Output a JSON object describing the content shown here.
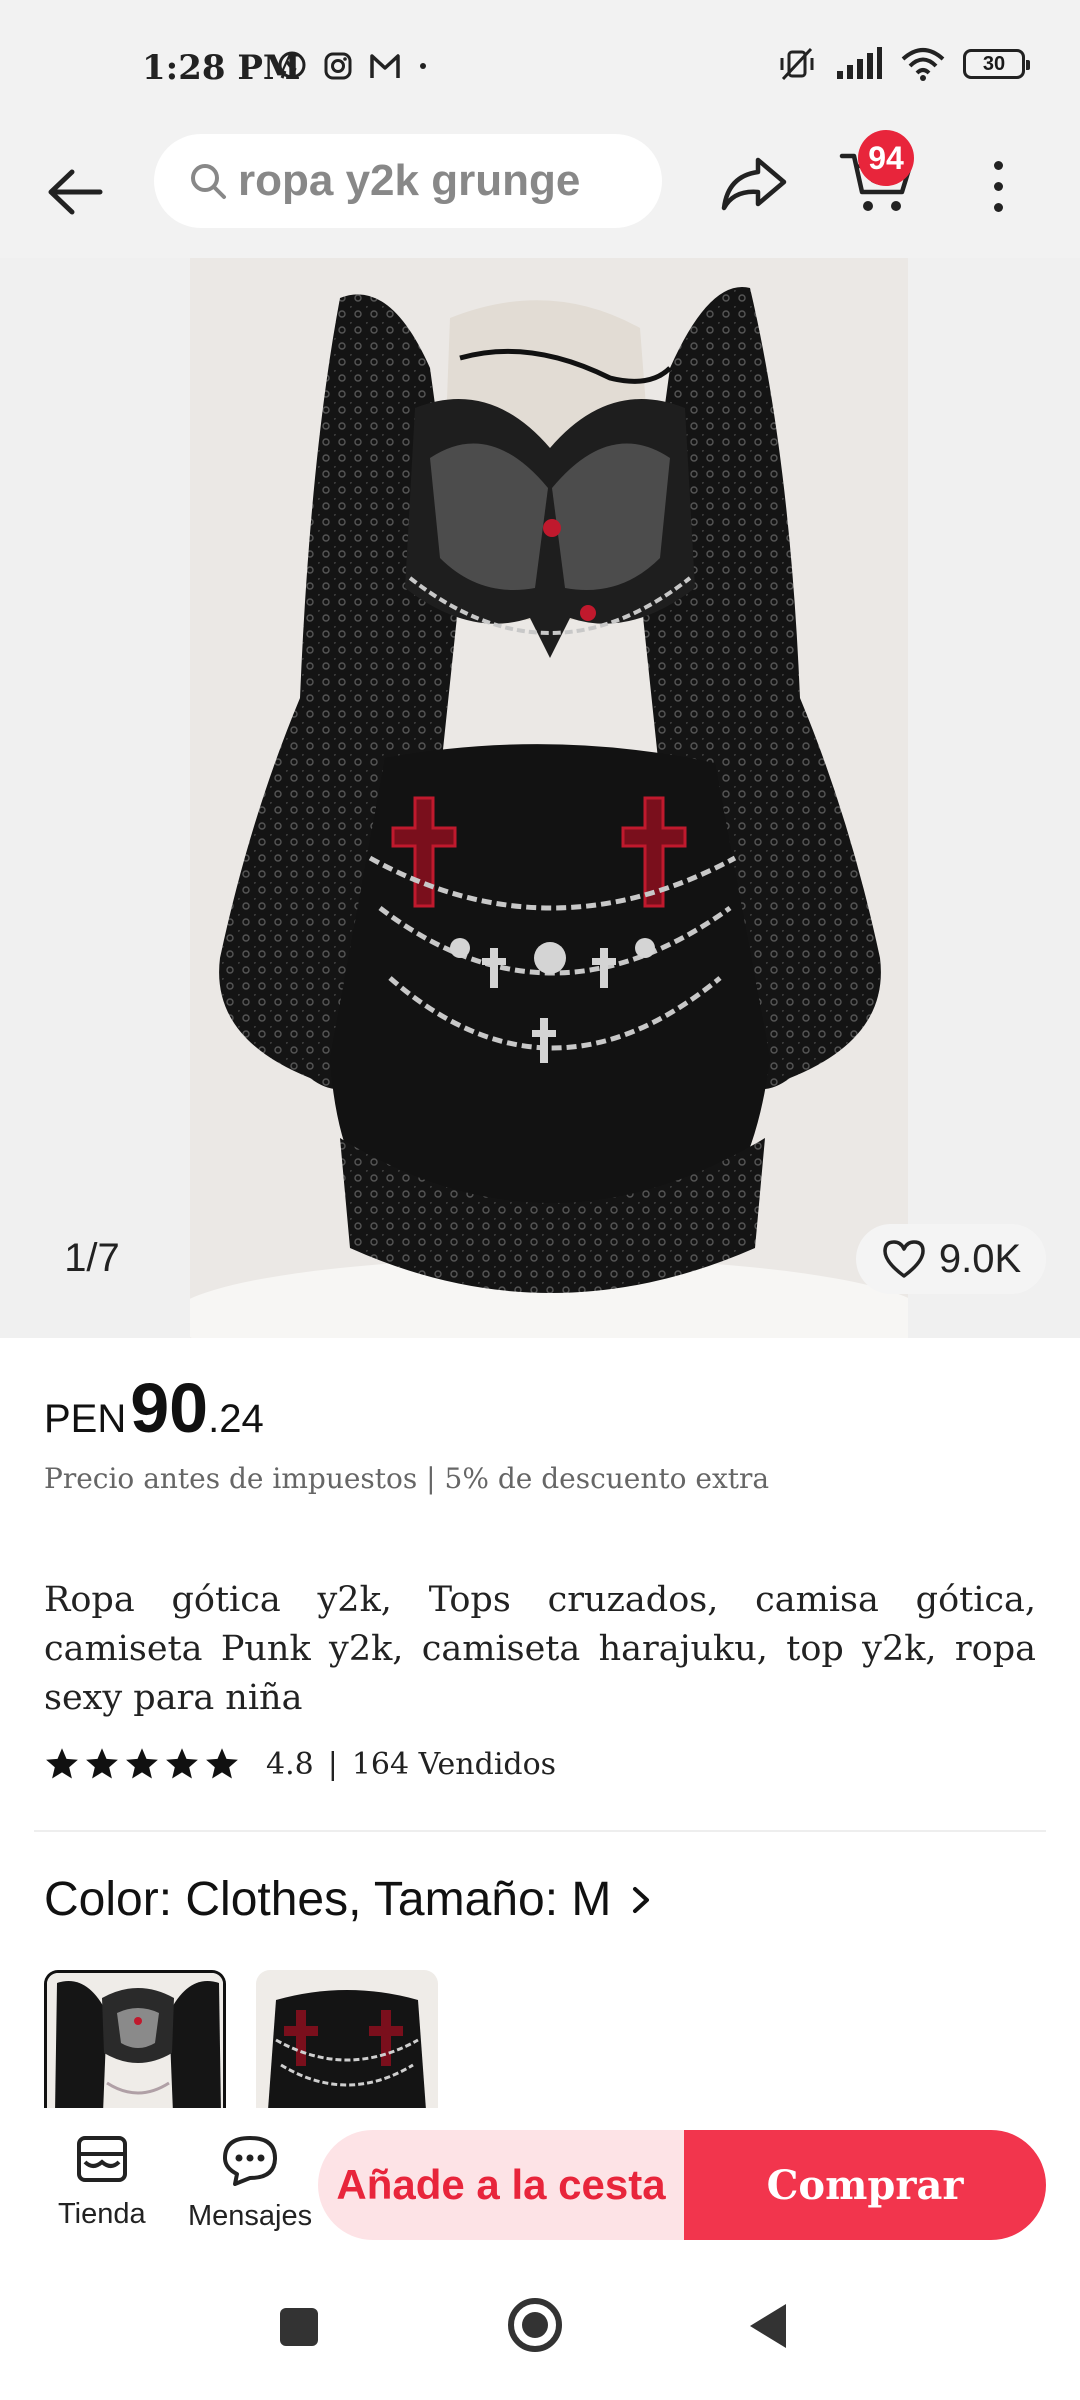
{
  "status_bar": {
    "time": "1:28 PM",
    "app_icons": [
      "whatsapp-icon",
      "instagram-icon",
      "gmail-icon",
      "dot-icon"
    ],
    "battery": "30"
  },
  "topnav": {
    "search_text": "ropa y2k grunge",
    "cart_count": "94"
  },
  "gallery": {
    "page_indicator": "1/7",
    "likes": "9.0K"
  },
  "product": {
    "currency": "PEN",
    "price_int": "90",
    "price_dec": ".24",
    "price_note": "Precio antes de impuestos | 5% de descuento extra",
    "title": "Ropa gótica y2k, Tops cruzados, camisa gótica, camiseta Punk y2k, camiseta harajuku, top y2k, ropa sexy para niña",
    "rating_stars": 5,
    "rating": "4.8",
    "separator": "|",
    "sold": "164 Vendidos",
    "variant": "Color: Clothes, Tamaño: M"
  },
  "bottom_bar": {
    "store_label": "Tienda",
    "messages_label": "Mensajes",
    "add_to_cart": "Añade a la cesta",
    "buy_now": "Comprar"
  },
  "colors": {
    "accent": "#e8253b",
    "buy_button": "#f2354d",
    "add_cart_bg": "#fde3e6"
  }
}
